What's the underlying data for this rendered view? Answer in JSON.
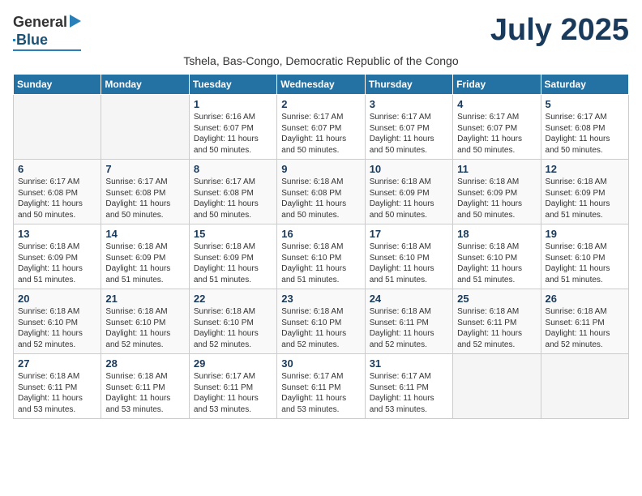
{
  "logo": {
    "general": "General",
    "blue": "Blue"
  },
  "title": "July 2025",
  "subtitle": "Tshela, Bas-Congo, Democratic Republic of the Congo",
  "days_of_week": [
    "Sunday",
    "Monday",
    "Tuesday",
    "Wednesday",
    "Thursday",
    "Friday",
    "Saturday"
  ],
  "weeks": [
    [
      {
        "day": "",
        "info": ""
      },
      {
        "day": "",
        "info": ""
      },
      {
        "day": "1",
        "info": "Sunrise: 6:16 AM\nSunset: 6:07 PM\nDaylight: 11 hours and 50 minutes."
      },
      {
        "day": "2",
        "info": "Sunrise: 6:17 AM\nSunset: 6:07 PM\nDaylight: 11 hours and 50 minutes."
      },
      {
        "day": "3",
        "info": "Sunrise: 6:17 AM\nSunset: 6:07 PM\nDaylight: 11 hours and 50 minutes."
      },
      {
        "day": "4",
        "info": "Sunrise: 6:17 AM\nSunset: 6:07 PM\nDaylight: 11 hours and 50 minutes."
      },
      {
        "day": "5",
        "info": "Sunrise: 6:17 AM\nSunset: 6:08 PM\nDaylight: 11 hours and 50 minutes."
      }
    ],
    [
      {
        "day": "6",
        "info": "Sunrise: 6:17 AM\nSunset: 6:08 PM\nDaylight: 11 hours and 50 minutes."
      },
      {
        "day": "7",
        "info": "Sunrise: 6:17 AM\nSunset: 6:08 PM\nDaylight: 11 hours and 50 minutes."
      },
      {
        "day": "8",
        "info": "Sunrise: 6:17 AM\nSunset: 6:08 PM\nDaylight: 11 hours and 50 minutes."
      },
      {
        "day": "9",
        "info": "Sunrise: 6:18 AM\nSunset: 6:08 PM\nDaylight: 11 hours and 50 minutes."
      },
      {
        "day": "10",
        "info": "Sunrise: 6:18 AM\nSunset: 6:09 PM\nDaylight: 11 hours and 50 minutes."
      },
      {
        "day": "11",
        "info": "Sunrise: 6:18 AM\nSunset: 6:09 PM\nDaylight: 11 hours and 50 minutes."
      },
      {
        "day": "12",
        "info": "Sunrise: 6:18 AM\nSunset: 6:09 PM\nDaylight: 11 hours and 51 minutes."
      }
    ],
    [
      {
        "day": "13",
        "info": "Sunrise: 6:18 AM\nSunset: 6:09 PM\nDaylight: 11 hours and 51 minutes."
      },
      {
        "day": "14",
        "info": "Sunrise: 6:18 AM\nSunset: 6:09 PM\nDaylight: 11 hours and 51 minutes."
      },
      {
        "day": "15",
        "info": "Sunrise: 6:18 AM\nSunset: 6:09 PM\nDaylight: 11 hours and 51 minutes."
      },
      {
        "day": "16",
        "info": "Sunrise: 6:18 AM\nSunset: 6:10 PM\nDaylight: 11 hours and 51 minutes."
      },
      {
        "day": "17",
        "info": "Sunrise: 6:18 AM\nSunset: 6:10 PM\nDaylight: 11 hours and 51 minutes."
      },
      {
        "day": "18",
        "info": "Sunrise: 6:18 AM\nSunset: 6:10 PM\nDaylight: 11 hours and 51 minutes."
      },
      {
        "day": "19",
        "info": "Sunrise: 6:18 AM\nSunset: 6:10 PM\nDaylight: 11 hours and 51 minutes."
      }
    ],
    [
      {
        "day": "20",
        "info": "Sunrise: 6:18 AM\nSunset: 6:10 PM\nDaylight: 11 hours and 52 minutes."
      },
      {
        "day": "21",
        "info": "Sunrise: 6:18 AM\nSunset: 6:10 PM\nDaylight: 11 hours and 52 minutes."
      },
      {
        "day": "22",
        "info": "Sunrise: 6:18 AM\nSunset: 6:10 PM\nDaylight: 11 hours and 52 minutes."
      },
      {
        "day": "23",
        "info": "Sunrise: 6:18 AM\nSunset: 6:10 PM\nDaylight: 11 hours and 52 minutes."
      },
      {
        "day": "24",
        "info": "Sunrise: 6:18 AM\nSunset: 6:11 PM\nDaylight: 11 hours and 52 minutes."
      },
      {
        "day": "25",
        "info": "Sunrise: 6:18 AM\nSunset: 6:11 PM\nDaylight: 11 hours and 52 minutes."
      },
      {
        "day": "26",
        "info": "Sunrise: 6:18 AM\nSunset: 6:11 PM\nDaylight: 11 hours and 52 minutes."
      }
    ],
    [
      {
        "day": "27",
        "info": "Sunrise: 6:18 AM\nSunset: 6:11 PM\nDaylight: 11 hours and 53 minutes."
      },
      {
        "day": "28",
        "info": "Sunrise: 6:18 AM\nSunset: 6:11 PM\nDaylight: 11 hours and 53 minutes."
      },
      {
        "day": "29",
        "info": "Sunrise: 6:17 AM\nSunset: 6:11 PM\nDaylight: 11 hours and 53 minutes."
      },
      {
        "day": "30",
        "info": "Sunrise: 6:17 AM\nSunset: 6:11 PM\nDaylight: 11 hours and 53 minutes."
      },
      {
        "day": "31",
        "info": "Sunrise: 6:17 AM\nSunset: 6:11 PM\nDaylight: 11 hours and 53 minutes."
      },
      {
        "day": "",
        "info": ""
      },
      {
        "day": "",
        "info": ""
      }
    ]
  ]
}
